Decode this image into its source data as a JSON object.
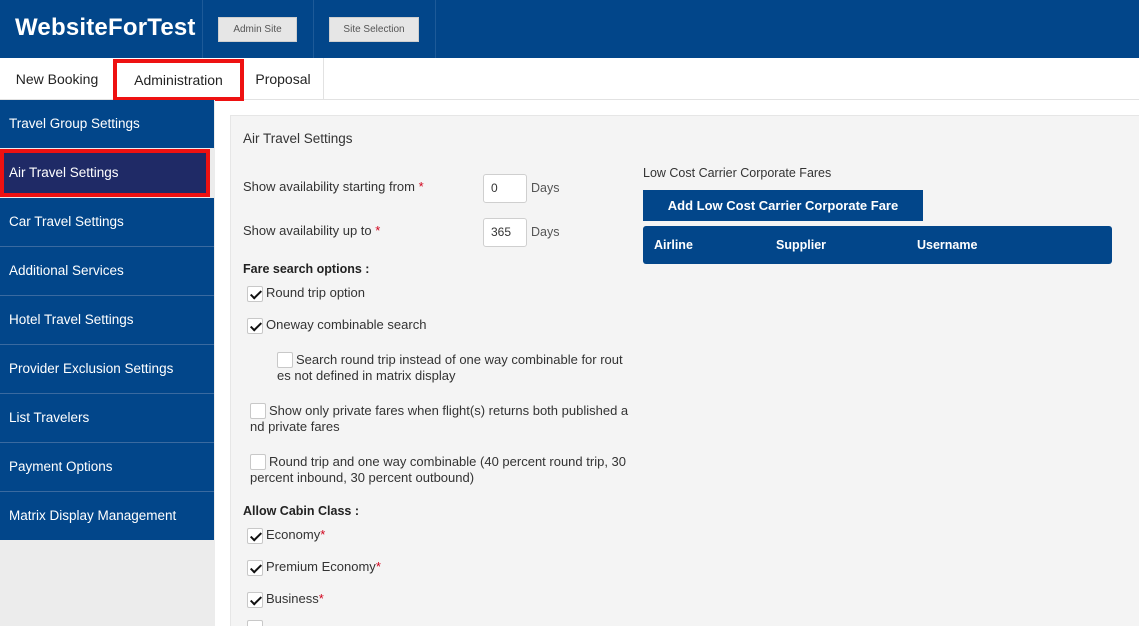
{
  "header": {
    "brand": "WebsiteForTest",
    "admin_site": "Admin Site",
    "site_selection": "Site Selection"
  },
  "tabs": [
    {
      "label": "New Booking"
    },
    {
      "label": "Administration",
      "active": true
    },
    {
      "label": "Proposal"
    }
  ],
  "sidebar": {
    "items": [
      {
        "label": "Travel Group Settings"
      },
      {
        "label": "Air Travel Settings",
        "active": true
      },
      {
        "label": "Car Travel Settings"
      },
      {
        "label": "Additional Services"
      },
      {
        "label": "Hotel Travel Settings"
      },
      {
        "label": "Provider Exclusion Settings"
      },
      {
        "label": "List Travelers"
      },
      {
        "label": "Payment Options"
      },
      {
        "label": "Matrix Display Management"
      }
    ]
  },
  "main": {
    "title": "Air Travel Settings",
    "availability_from": {
      "label": "Show availability starting from",
      "required": "*",
      "value": "0",
      "unit": "Days"
    },
    "availability_to": {
      "label": "Show availability up to",
      "required": "*",
      "value": "365",
      "unit": "Days"
    },
    "fare_search": {
      "heading": "Fare search options :",
      "options": [
        {
          "label": "Round trip option",
          "checked": true
        },
        {
          "label": "Oneway combinable search",
          "checked": true
        },
        {
          "label_line1": "Search round trip instead of one way combinable for rout",
          "label_line2": "es not defined in matrix display",
          "checked": false
        },
        {
          "label_line1": "Show only private fares when flight(s) returns both published a",
          "label_line2": "nd private fares",
          "checked": false
        },
        {
          "label_line1": "Round trip and one way combinable (40 percent round trip, 30",
          "label_line2": "percent inbound, 30 percent outbound)",
          "checked": false
        }
      ]
    },
    "cabin": {
      "heading": "Allow Cabin Class :",
      "options": [
        {
          "label": "Economy",
          "required": "*",
          "checked": true
        },
        {
          "label": "Premium Economy",
          "required": "*",
          "checked": true
        },
        {
          "label": "Business",
          "required": "*",
          "checked": true
        }
      ]
    },
    "lcc": {
      "title": "Low Cost Carrier Corporate Fares",
      "add_button": "Add Low Cost Carrier Corporate Fare",
      "columns": [
        "Airline",
        "Supplier",
        "Username"
      ]
    }
  },
  "colors": {
    "primary": "#02468a",
    "sidebar_active": "#1f2a66",
    "highlight": "#ee1111",
    "required": "#d0021b"
  }
}
